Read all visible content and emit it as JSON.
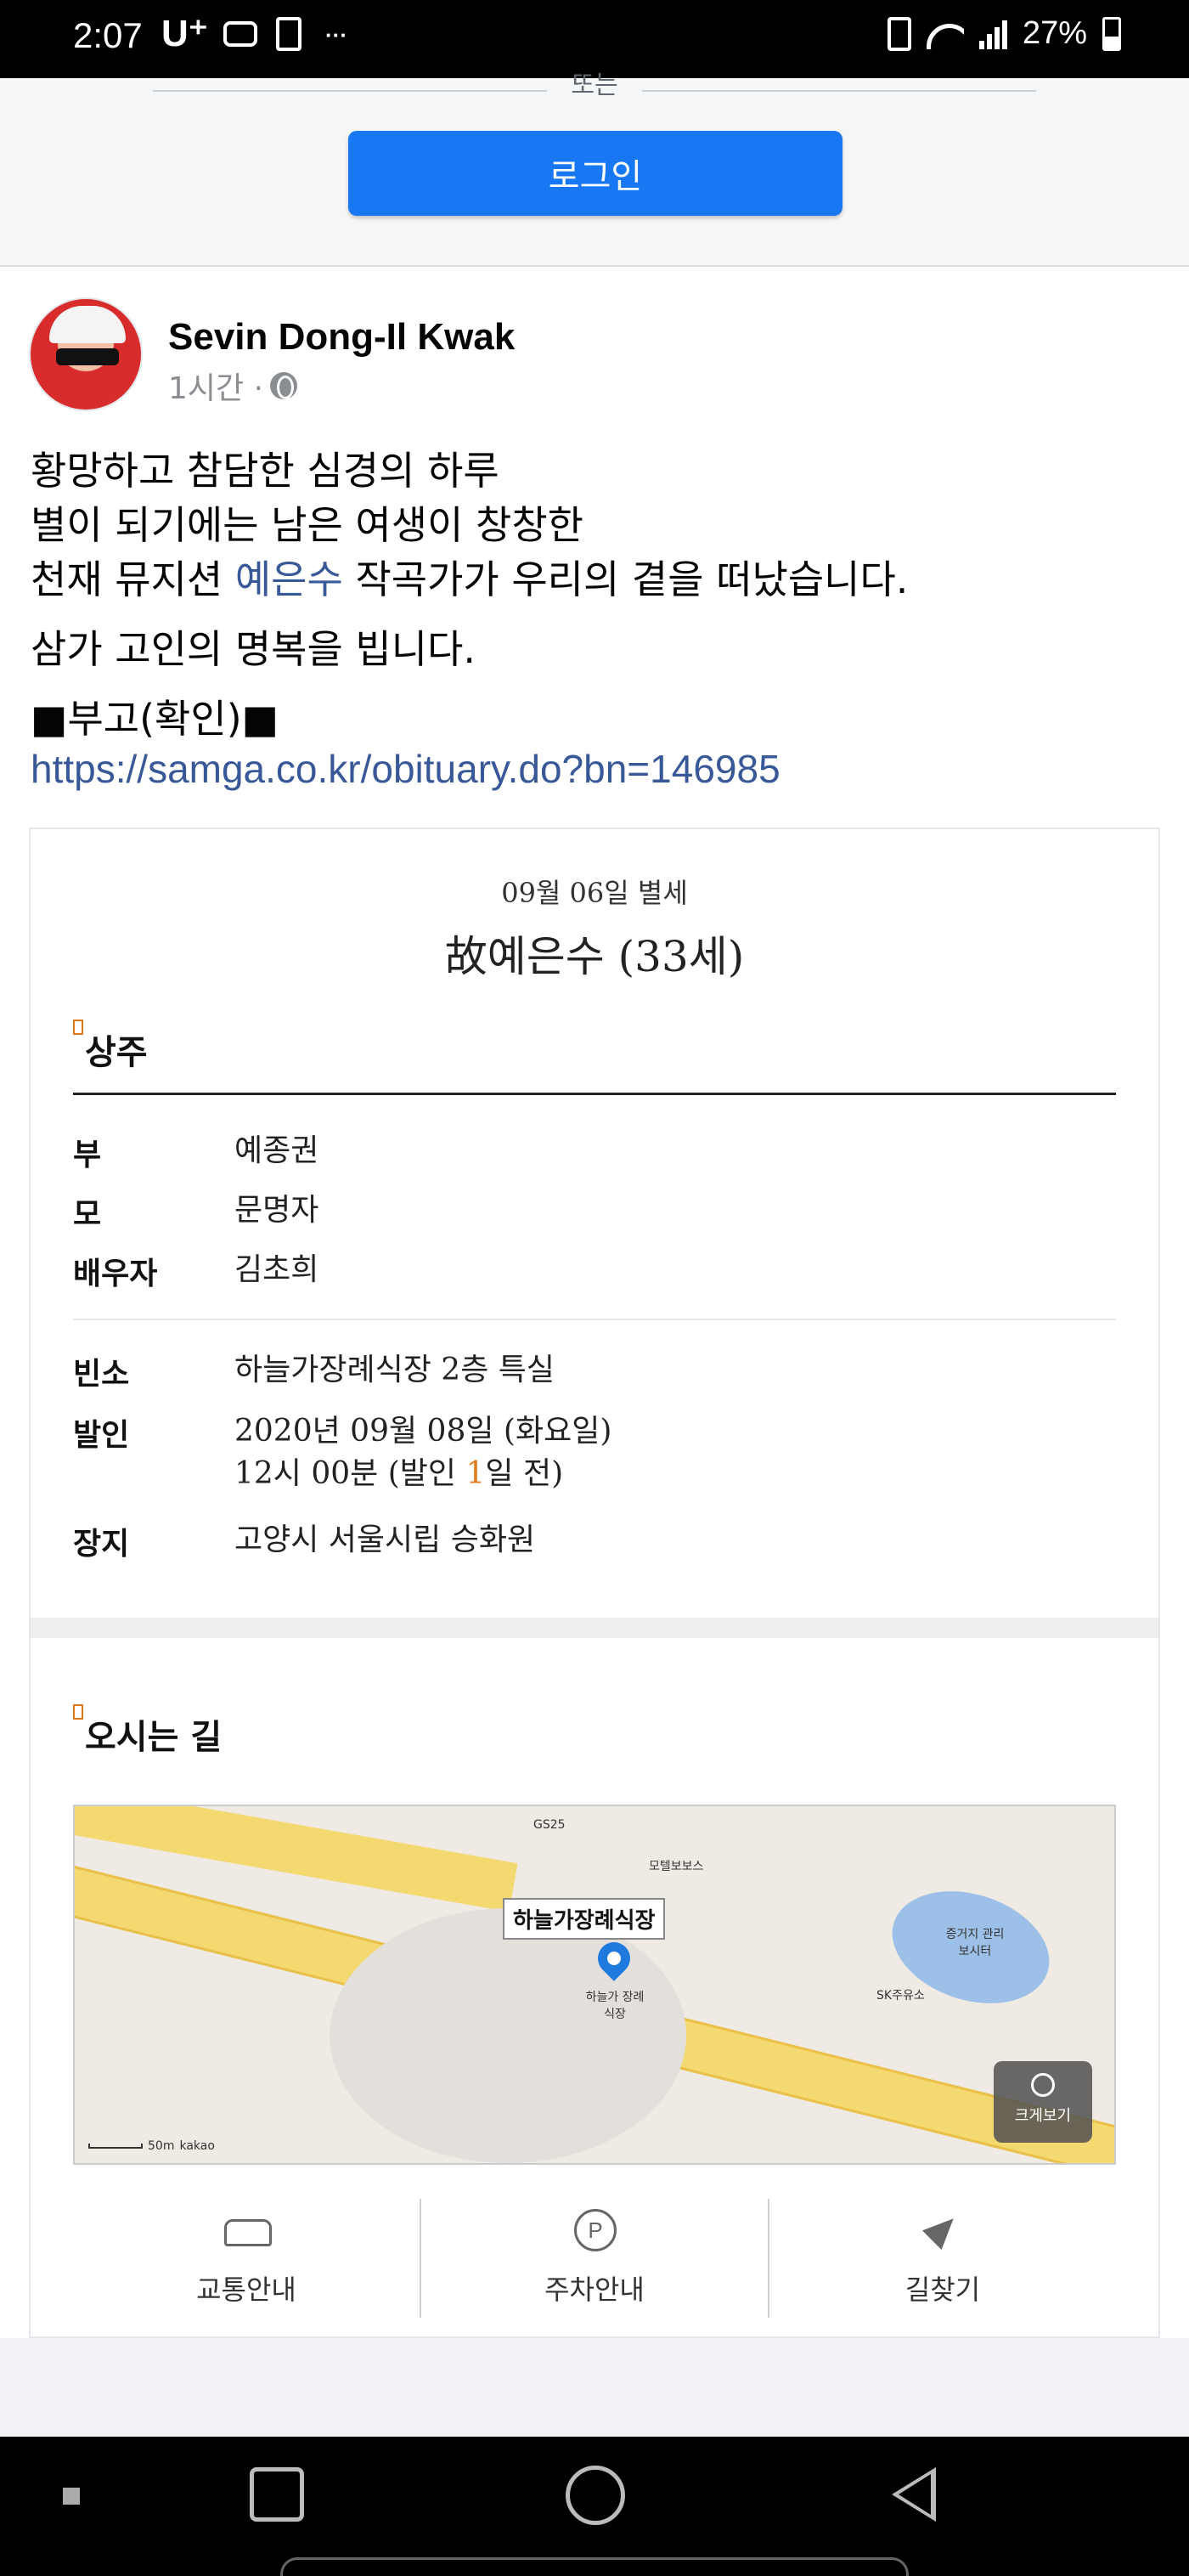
{
  "status_bar": {
    "time": "2:07",
    "carrier": "U⁺",
    "battery": "27%"
  },
  "login": {
    "or_text": "또는",
    "button_label": "로그인"
  },
  "post": {
    "author": "Sevin Dong-Il Kwak",
    "time": "1시간 ·",
    "lines": [
      "황망하고 참담한 심경의 하루",
      "별이 되기에는 남은 여생이 창창한"
    ],
    "line3_pre": "천재 뮤지션 ",
    "line3_mention": "예은수",
    "line3_post": " 작곡가가 우리의 곁을 떠났습니다.",
    "line4": "삼가 고인의 명복을 빕니다.",
    "line5": "■부고(확인)■",
    "link": "https://samga.co.kr/obituary.do?bn=146985"
  },
  "obituary": {
    "date": "09월 06일 별세",
    "name": "故예은수 (33세)",
    "mourners_title": "상주",
    "mourners": [
      {
        "key": "부",
        "value": "예종권"
      },
      {
        "key": "모",
        "value": "문명자"
      },
      {
        "key": "배우자",
        "value": "김초희"
      }
    ],
    "room_key": "빈소",
    "room_value": "하늘가장례식장 2층 특실",
    "departure_key": "발인",
    "departure_line1": "2020년 09월 08일 (화요일)",
    "departure_line2_pre": "12시 00분 (발인 ",
    "departure_line2_hl": "1",
    "departure_line2_post": "일 전)",
    "burial_key": "장지",
    "burial_value": "고양시 서울시립 승화원"
  },
  "directions": {
    "title": "오시는 길",
    "map_badge": "하늘가장례식장",
    "map_labels": {
      "gs25": "GS25",
      "motel": "모텔보보스",
      "funeral": "하늘가 장례식장",
      "lake": "증거지 관리보시터",
      "sk": "SK주유소",
      "scale": "50m",
      "brand": "kakao"
    },
    "zoom_label": "크게보기",
    "actions": [
      {
        "label": "교통안내",
        "icon": "car-icon"
      },
      {
        "label": "주차안내",
        "icon": "parking-icon"
      },
      {
        "label": "길찾기",
        "icon": "navigation-icon"
      }
    ]
  },
  "colors": {
    "brand_blue": "#1877f2",
    "link": "#385898",
    "accent_orange": "#e07b1c"
  }
}
